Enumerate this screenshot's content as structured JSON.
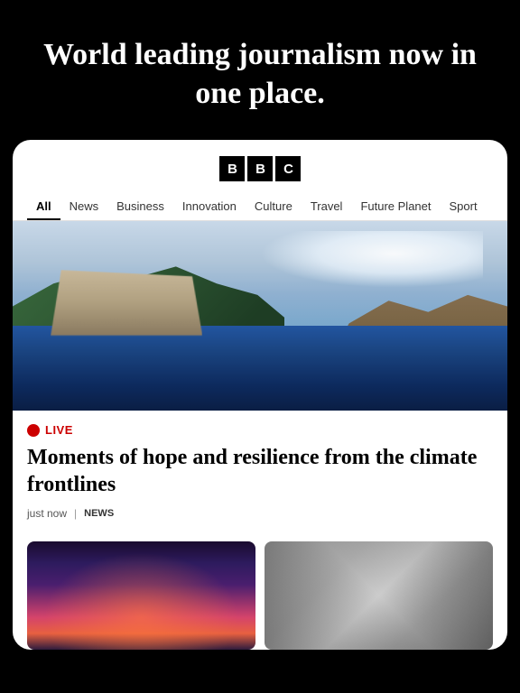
{
  "hero": {
    "title": "World leading journalism now in one place."
  },
  "bbc": {
    "logo_letters": [
      "B",
      "B",
      "C"
    ]
  },
  "nav": {
    "items": [
      {
        "label": "All",
        "active": true
      },
      {
        "label": "News",
        "active": false
      },
      {
        "label": "Business",
        "active": false
      },
      {
        "label": "Innovation",
        "active": false
      },
      {
        "label": "Culture",
        "active": false
      },
      {
        "label": "Travel",
        "active": false
      },
      {
        "label": "Future Planet",
        "active": false
      },
      {
        "label": "Sport",
        "active": false
      }
    ]
  },
  "article": {
    "live_label": "LIVE",
    "title": "Moments of hope and resilience from the climate frontlines",
    "timestamp": "just now",
    "separator": "|",
    "category": "NEWS"
  },
  "colors": {
    "accent_red": "#cc0000",
    "live_dot": "#cc0000"
  }
}
